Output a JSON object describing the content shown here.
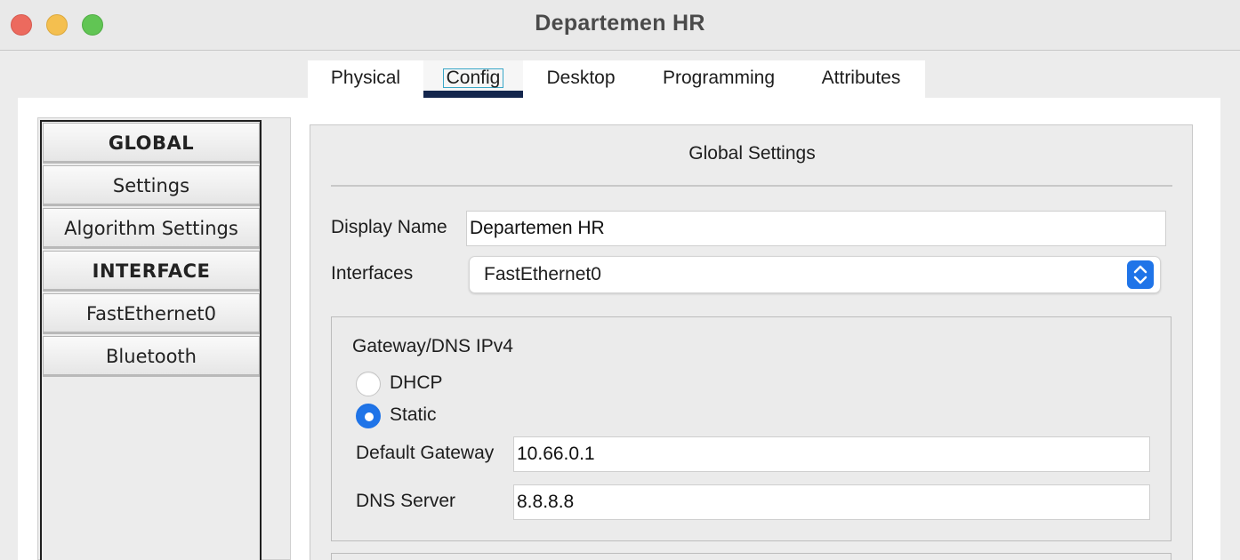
{
  "window": {
    "title": "Departemen HR"
  },
  "tabs": [
    {
      "label": "Physical"
    },
    {
      "label": "Config"
    },
    {
      "label": "Desktop"
    },
    {
      "label": "Programming"
    },
    {
      "label": "Attributes"
    }
  ],
  "active_tab": "Config",
  "sidebar": {
    "items": [
      {
        "label": "GLOBAL",
        "type": "header"
      },
      {
        "label": "Settings",
        "type": "item"
      },
      {
        "label": "Algorithm Settings",
        "type": "item"
      },
      {
        "label": "INTERFACE",
        "type": "header"
      },
      {
        "label": "FastEthernet0",
        "type": "item"
      },
      {
        "label": "Bluetooth",
        "type": "item"
      }
    ]
  },
  "global_settings": {
    "title": "Global Settings",
    "display_name_label": "Display Name",
    "display_name_value": "Departemen HR",
    "interfaces_label": "Interfaces",
    "interfaces_value": "FastEthernet0",
    "gateway_group": {
      "title": "Gateway/DNS IPv4",
      "dhcp_label": "DHCP",
      "static_label": "Static",
      "selected_mode": "Static",
      "default_gateway_label": "Default Gateway",
      "default_gateway_value": "10.66.0.1",
      "dns_server_label": "DNS Server",
      "dns_server_value": "8.8.8.8"
    }
  },
  "colors": {
    "accent": "#1f74e8",
    "active_tab_underline": "#14264d",
    "close": "#ec6a5e",
    "minimize": "#f4bf4f",
    "maximize": "#61c554"
  }
}
